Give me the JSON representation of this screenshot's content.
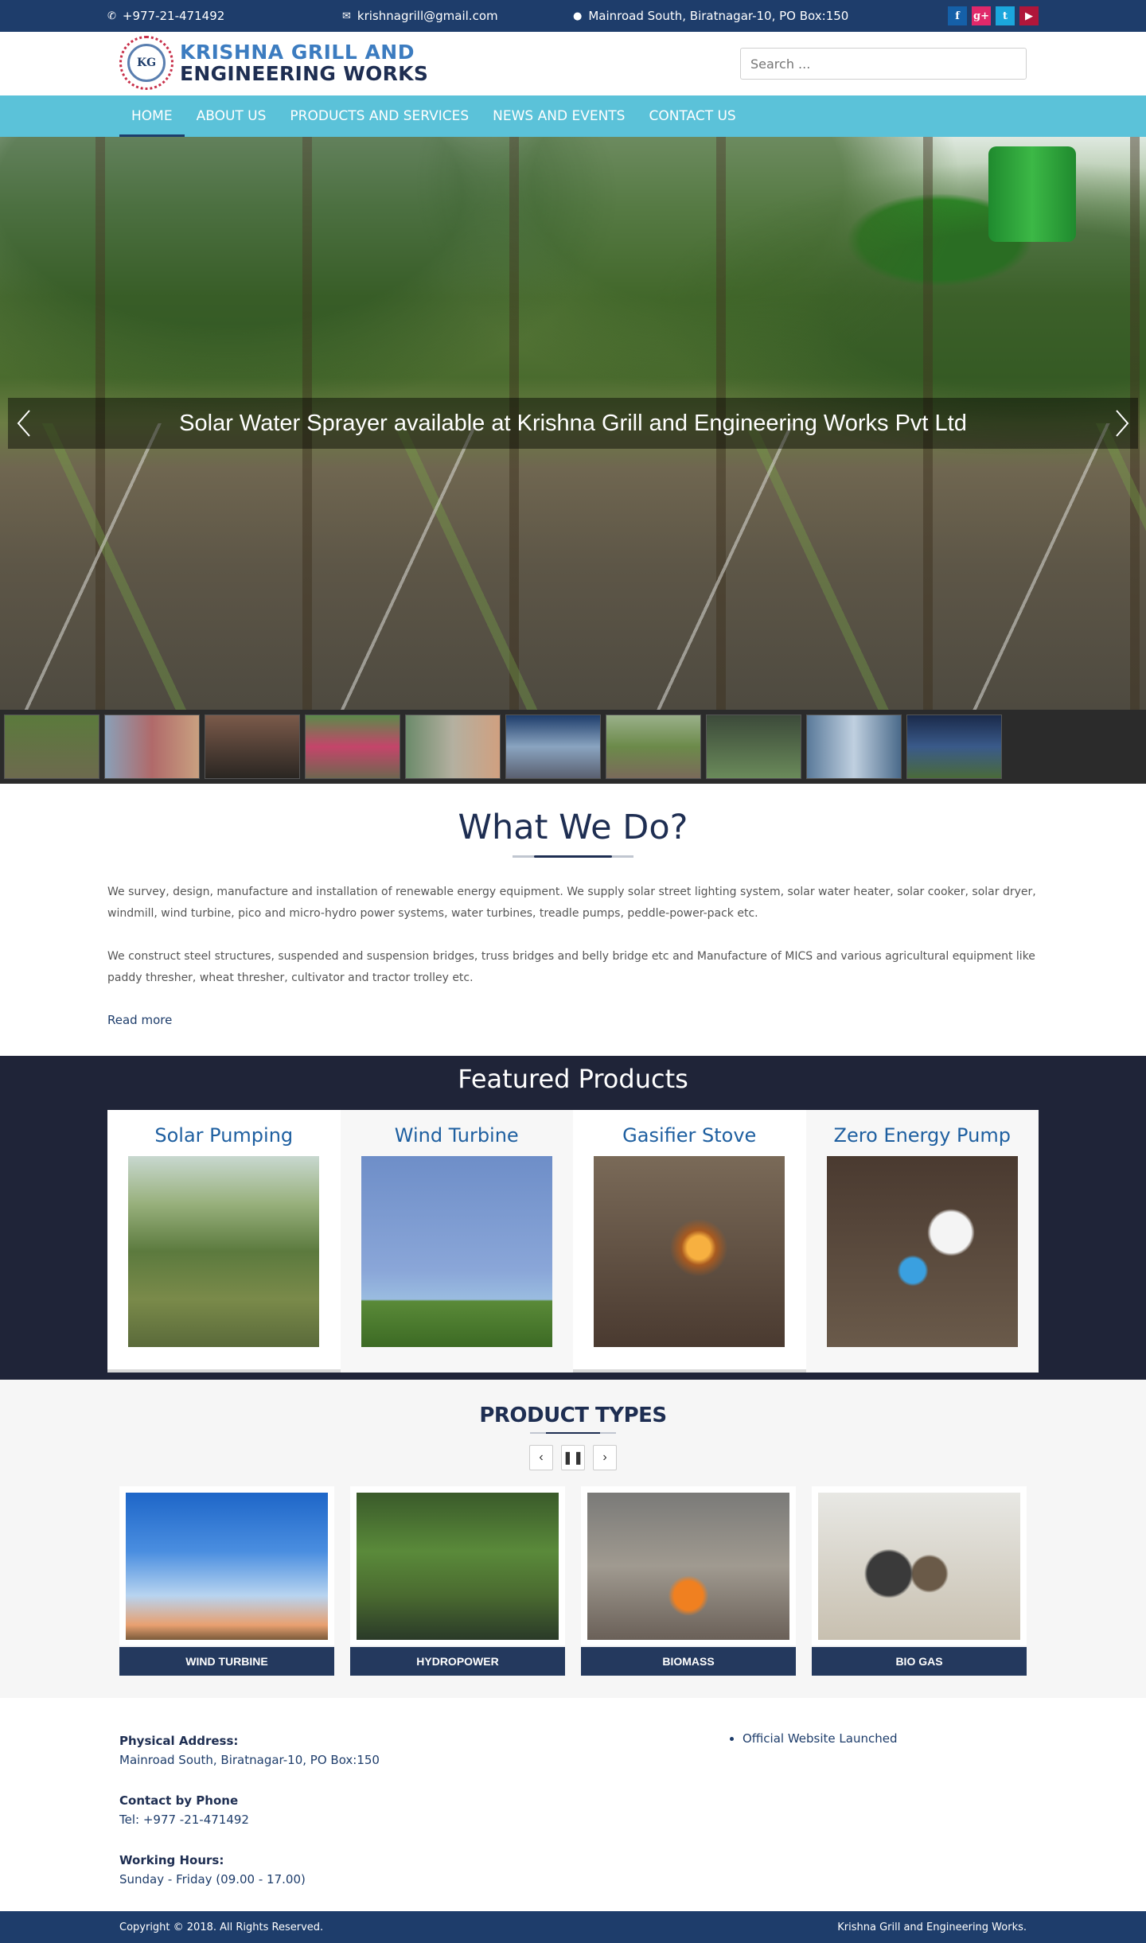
{
  "topbar": {
    "phone": "+977-21-471492",
    "email": "krishnagrill@gmail.com",
    "address": "Mainroad South, Biratnagar-10, PO Box:150",
    "socials": [
      {
        "name": "facebook",
        "glyph": "f"
      },
      {
        "name": "google-plus",
        "glyph": "g+"
      },
      {
        "name": "twitter",
        "glyph": "t"
      },
      {
        "name": "youtube",
        "glyph": "▶"
      }
    ]
  },
  "header": {
    "logo_line1": "KRISHNA GRILL AND",
    "logo_line2": "ENGINEERING WORKS",
    "logo_monogram": "KG",
    "search_placeholder": "Search ..."
  },
  "nav": {
    "items": [
      "HOME",
      "ABOUT US",
      "PRODUCTS AND SERVICES",
      "NEWS AND EVENTS",
      "CONTACT US"
    ]
  },
  "hero": {
    "caption": "Solar Water Sprayer available at Krishna Grill and Engineering Works Pvt Ltd"
  },
  "what_we_do": {
    "title": "What We Do?",
    "paragraph1": "We survey, design, manufacture and installation of renewable energy equipment. We supply solar street lighting system, solar water heater, solar cooker, solar dryer, windmill, wind turbine, pico and micro-hydro power systems, water turbines, treadle pumps, peddle-power-pack etc.",
    "paragraph2": "We construct steel structures, suspended and suspension bridges, truss bridges and belly bridge etc and Manufacture of MICS and various agricultural equipment like paddy thresher, wheat thresher, cultivator and tractor trolley etc.",
    "read_more": "Read more"
  },
  "featured": {
    "title": "Featured Products",
    "products": [
      "Solar Pumping",
      "Wind Turbine",
      "Gasifier Stove",
      "Zero Energy Pump"
    ]
  },
  "product_types": {
    "title": "PRODUCT TYPES",
    "controls": {
      "prev": "‹",
      "pause": "❚❚",
      "next": "›"
    },
    "items": [
      "WIND TURBINE",
      "HYDROPOWER",
      "BIOMASS",
      "BIO GAS"
    ]
  },
  "footer": {
    "address_label": "Physical Address:",
    "address_value": "Mainroad South, Biratnagar-10, PO Box:150",
    "phone_label": "Contact by Phone",
    "phone_value": "Tel: +977 -21-471492",
    "hours_label": "Working Hours:",
    "hours_value": "Sunday - Friday (09.00 - 17.00)",
    "news": [
      "Official Website Launched"
    ]
  },
  "bottom": {
    "copyright": "Copyright © 2018. All Rights Reserved.",
    "company": "Krishna Grill and Engineering Works."
  }
}
